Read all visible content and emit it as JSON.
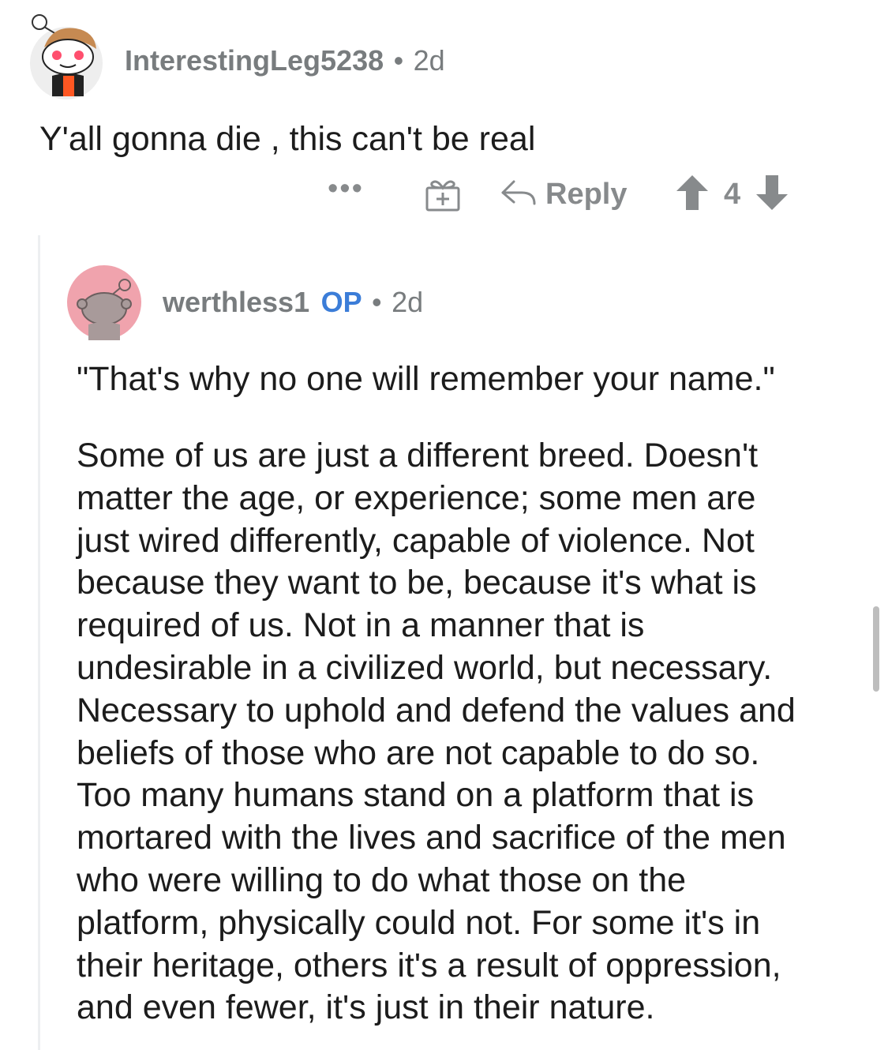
{
  "comment": {
    "username": "InterestingLeg5238",
    "separator": "•",
    "age": "2d",
    "text": "Y'all gonna die , this can't be real",
    "actions": {
      "more_label": "•••",
      "reply_label": "Reply",
      "vote_count": "4"
    }
  },
  "reply": {
    "username": "werthless1",
    "op_badge": "OP",
    "separator": "•",
    "age": "2d",
    "quote": "\"That's why no one will remember your name.\"",
    "body_lines": [
      "Some of us are just a different breed. Doesn't",
      "matter the age, or experience; some men are",
      "just wired differently, capable of violence. Not",
      "because they want to be, because it's what is",
      "required of us. Not in a manner that is",
      "undesirable in a civilized world, but necessary.",
      "Necessary to uphold and defend the values and",
      "beliefs of those who are not capable to do so.",
      "Too many humans stand on a platform that is",
      "mortared with the lives and sacrifice of the men",
      "who were willing to do what those on the",
      "platform, physically could not. For some it's in",
      "their heritage, others it's a result of oppression,",
      "and even fewer, it's just in their nature."
    ]
  },
  "icons": {
    "gift": "gift-icon",
    "reply": "reply-arrow-icon",
    "upvote": "upvote-arrow-icon",
    "downvote": "downvote-arrow-icon"
  },
  "colors": {
    "meta_gray": "#787c7e",
    "op_blue": "#3b7dd8",
    "vote_gray": "#878a8c",
    "text": "#1c1c1c"
  }
}
